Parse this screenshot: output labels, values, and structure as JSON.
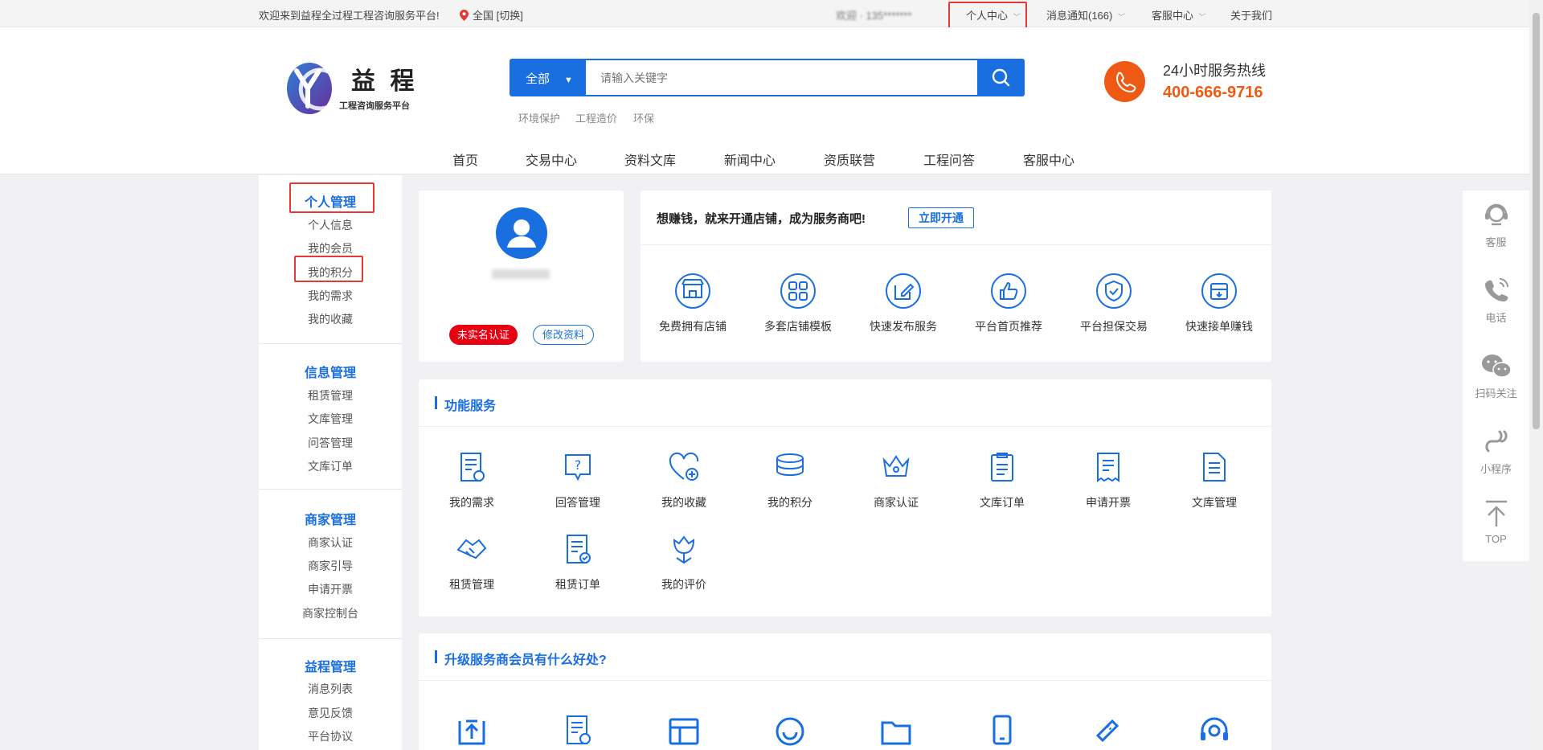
{
  "topbar": {
    "welcome": "欢迎来到益程全过程工程咨询服务平台!",
    "location": "全国 [切换]",
    "user_greeting": "欢迎 · 135*******",
    "personal_center": "个人中心",
    "messages": "消息通知(166)",
    "service_center": "客服中心",
    "about": "关于我们"
  },
  "header": {
    "brand_name": "益 程",
    "brand_sub": "工程咨询服务平台",
    "search_scope": "全部",
    "search_placeholder": "请输入关键字",
    "hot_keywords": [
      "环境保护",
      "工程造价",
      "环保"
    ],
    "hotline_title": "24小时服务热线",
    "hotline_number": "400-666-9716"
  },
  "nav": [
    "首页",
    "交易中心",
    "资料文库",
    "新闻中心",
    "资质联营",
    "工程问答",
    "客服中心"
  ],
  "sidebar": [
    {
      "title": "个人管理",
      "items": [
        "个人信息",
        "我的会员",
        "我的积分",
        "我的需求",
        "我的收藏"
      ]
    },
    {
      "title": "信息管理",
      "items": [
        "租赁管理",
        "文库管理",
        "问答管理",
        "文库订单"
      ]
    },
    {
      "title": "商家管理",
      "items": [
        "商家认证",
        "商家引导",
        "申请开票",
        "商家控制台"
      ]
    },
    {
      "title": "益程管理",
      "items": [
        "消息列表",
        "意见反馈",
        "平台协议"
      ]
    }
  ],
  "profile": {
    "badge_unverified": "未实名认证",
    "edit_button": "修改资料"
  },
  "promo": {
    "headline": "想赚钱，就来开通店铺，成为服务商吧!",
    "open_button": "立即开通",
    "features": [
      "免费拥有店铺",
      "多套店铺模板",
      "快速发布服务",
      "平台首页推荐",
      "平台担保交易",
      "快速接单赚钱"
    ]
  },
  "functions": {
    "title": "功能服务",
    "items": [
      "我的需求",
      "回答管理",
      "我的收藏",
      "我的积分",
      "商家认证",
      "文库订单",
      "申请开票",
      "文库管理",
      "租赁管理",
      "租赁订单",
      "我的评价"
    ]
  },
  "upgrade": {
    "title": "升级服务商会员有什么好处?"
  },
  "right_panel": [
    "客服",
    "电话",
    "扫码关注",
    "小程序",
    "TOP"
  ],
  "colors": {
    "primary": "#1a6fe0",
    "accent_orange": "#ee5a14",
    "badge_red": "#e60012",
    "highlight_box": "#e53935"
  }
}
